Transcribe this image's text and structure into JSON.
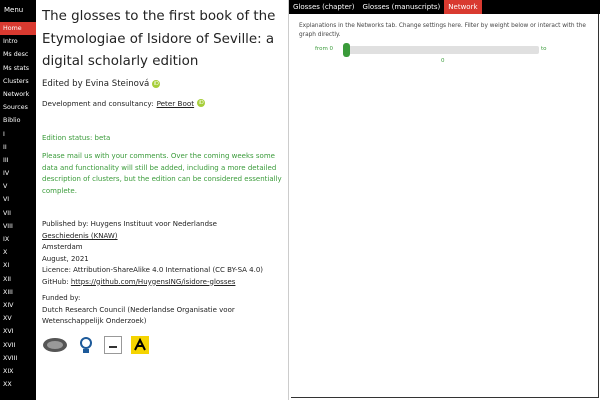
{
  "nav": {
    "menu_label": "Menu",
    "items": [
      "Home",
      "Intro",
      "Ms desc",
      "Ms stats",
      "Clusters",
      "Network",
      "Sources",
      "Biblio",
      "I",
      "II",
      "III",
      "IV",
      "V",
      "VI",
      "VII",
      "VIII",
      "IX",
      "X",
      "XI",
      "XII",
      "XIII",
      "XIV",
      "XV",
      "XVI",
      "XVII",
      "XVIII",
      "XIX",
      "XX"
    ],
    "active_index": 0
  },
  "intro": {
    "title": "The glosses to the first book of the Etymologiae of Isidore of Seville: a digital scholarly edition",
    "edited_by": "Edited by Evina Steinová",
    "dev_prefix": "Development and consultancy:",
    "dev_name": "Peter Boot",
    "status": "Edition status: beta",
    "please": "Please mail us with your comments. Over the coming weeks some data and functionality will still be added, including a more detailed description of clusters, but the edition can be considered essentially complete.",
    "published_prefix": "Published by: Huygens Instituut voor Nederlandse",
    "published_link": "Geschiedenis (KNAW)",
    "place": "Amsterdam",
    "date": "August, 2021",
    "licence": "Licence: Attribution-ShareAlike 4.0 International (CC BY-SA 4.0)",
    "github_prefix": "GitHub:",
    "github_link": "https://github.com/HuygensING/isidore-glosses",
    "funded_label": "Funded by:",
    "funded_line1": "Dutch Research Council (Nederlandse Organisatie voor",
    "funded_line2": "Wetenschappelijk Onderzoek)"
  },
  "tabs": [
    {
      "label": "Glosses (chapter)"
    },
    {
      "label": "Glosses (manuscripts)"
    },
    {
      "label": "Network"
    }
  ],
  "network": {
    "help": "Explanations in the Networks tab. Change settings here. Filter by weight below or interact with the graph directly.",
    "from_label": "from 0",
    "to_label": "to",
    "value": "0",
    "slider_value": 0
  },
  "colors": {
    "accent": "#d93a30",
    "green": "#3a9b3a"
  }
}
